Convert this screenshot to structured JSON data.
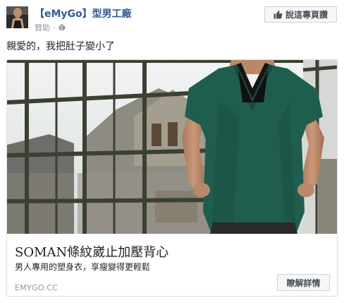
{
  "post": {
    "page_name": "【eMyGo】型男工廠",
    "sponsored": "贊助",
    "separator": "·",
    "like_page_label": "說這專頁讚",
    "message": "親愛的，我把肚子變小了"
  },
  "ad": {
    "headline": "SOMAN條紋崴止加壓背心",
    "description": "男人專用的塑身衣，享瘦變得更輕鬆",
    "domain": "EMYGO.CC",
    "cta_label": "瞭解詳情"
  },
  "colors": {
    "link_blue": "#365899",
    "muted_gray": "#90949c",
    "shirt_green": "#1f5e4e"
  },
  "icons": {
    "like": "thumbs-up-icon",
    "privacy": "globe-icon"
  }
}
